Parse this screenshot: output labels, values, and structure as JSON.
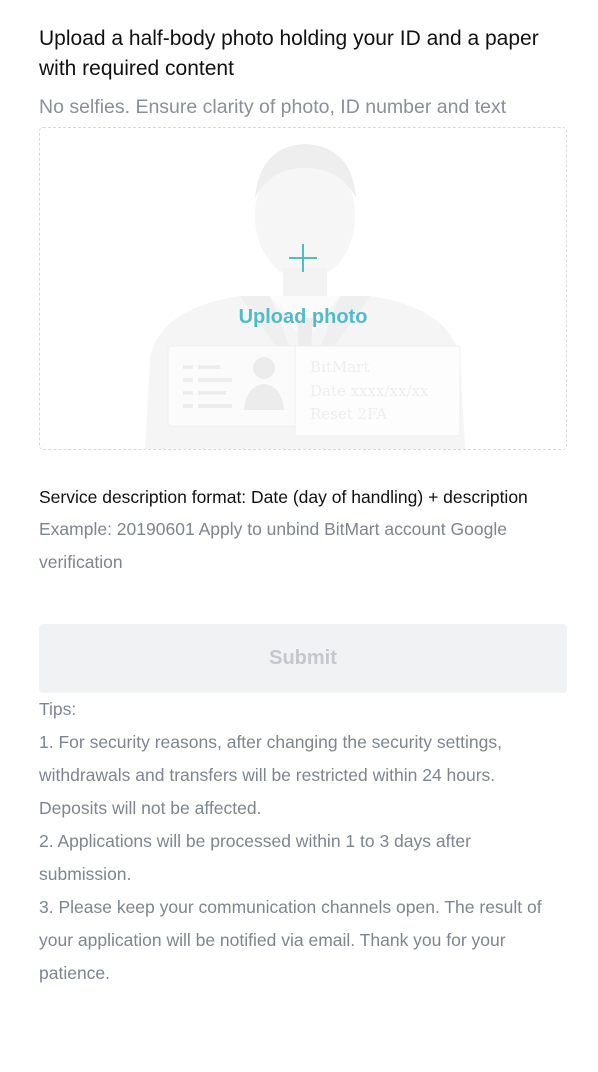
{
  "upload": {
    "heading": "Upload a half-body photo holding your ID and a paper with required content",
    "subheading": "No selfies. Ensure clarity of photo, ID number and text",
    "button_label": "Upload photo",
    "sample_card": {
      "brand": "BitMart",
      "date": "Date xxxx/xx/xx",
      "action": "Reset 2FA"
    }
  },
  "service": {
    "title": "Service description format: Date (day of handling) + description",
    "example": "Example: 20190601 Apply to unbind BitMart account Google verification"
  },
  "submit": {
    "label": "Submit",
    "disabled": true
  },
  "tips": {
    "heading": "Tips:",
    "items": [
      "1. For security reasons, after changing the security settings, withdrawals and transfers will be restricted within 24 hours. Deposits will not be affected.",
      "2. Applications will be processed within 1 to 3 days after submission.",
      "3. Please keep your communication channels open. The result of your application will be notified via email. Thank you for your patience."
    ]
  },
  "colors": {
    "accent": "#52bcc5",
    "muted_text": "#7e858f",
    "disabled_bg": "#f1f2f4",
    "disabled_text": "#c4c7cc"
  }
}
